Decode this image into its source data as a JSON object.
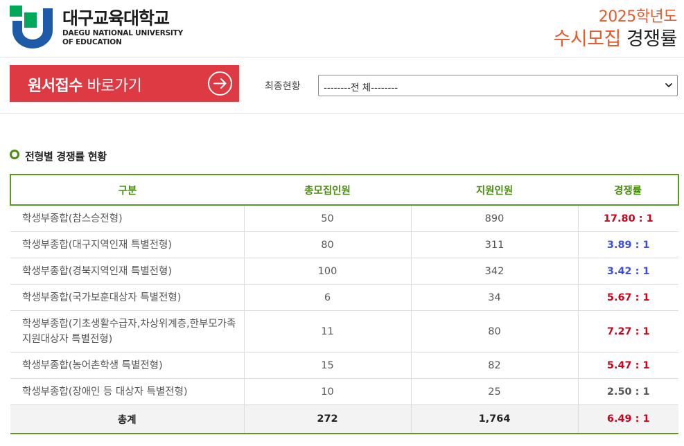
{
  "header": {
    "logo_kr": "대구교육대학교",
    "logo_en_line1": "DAEGU NATIONAL UNIVERSITY",
    "logo_en_line2": "OF EDUCATION",
    "year": "2025학년도",
    "title_part1": "수시모집",
    "title_part2": "경쟁률"
  },
  "apply": {
    "label_bold": "원서접수",
    "label_rest": " 바로가기",
    "icon": "arrow-right-circle-icon"
  },
  "status": {
    "label": "최종현황",
    "selected": "--------전 체--------"
  },
  "section": {
    "title": "전형별 경쟁률 현황"
  },
  "table": {
    "headers": [
      "구분",
      "총모집인원",
      "지원인원",
      "경쟁률"
    ],
    "rows": [
      {
        "category": "학생부종합(참스승전형)",
        "quota": "50",
        "applicants": "890",
        "rate": "17.80 : 1",
        "rate_color": "#d0021b"
      },
      {
        "category": "학생부종합(대구지역인재 특별전형)",
        "quota": "80",
        "applicants": "311",
        "rate": "3.89 : 1",
        "rate_color": "#3b4fd8"
      },
      {
        "category": "학생부종합(경북지역인재 특별전형)",
        "quota": "100",
        "applicants": "342",
        "rate": "3.42 : 1",
        "rate_color": "#3b4fd8"
      },
      {
        "category": "학생부종합(국가보훈대상자 특별전형)",
        "quota": "6",
        "applicants": "34",
        "rate": "5.67 : 1",
        "rate_color": "#d0021b"
      },
      {
        "category": "학생부종합(기초생활수급자,차상위계층,한부모가족 지원대상자 특별전형)",
        "quota": "11",
        "applicants": "80",
        "rate": "7.27 : 1",
        "rate_color": "#d0021b"
      },
      {
        "category": "학생부종합(농어촌학생 특별전형)",
        "quota": "15",
        "applicants": "82",
        "rate": "5.47 : 1",
        "rate_color": "#d0021b"
      },
      {
        "category": "학생부종합(장애인 등 대상자 특별전형)",
        "quota": "10",
        "applicants": "25",
        "rate": "2.50 : 1",
        "rate_color": "#555555"
      }
    ],
    "total": {
      "label": "총계",
      "quota": "272",
      "applicants": "1,764",
      "rate": "6.49 : 1",
      "rate_color": "#d0021b"
    }
  },
  "colors": {
    "accent_red": "#dd3a43",
    "header_orange": "#e8582b",
    "table_green": "#5a9a1e",
    "logo_green": "#00a85a",
    "logo_blue": "#1f5aa8"
  }
}
